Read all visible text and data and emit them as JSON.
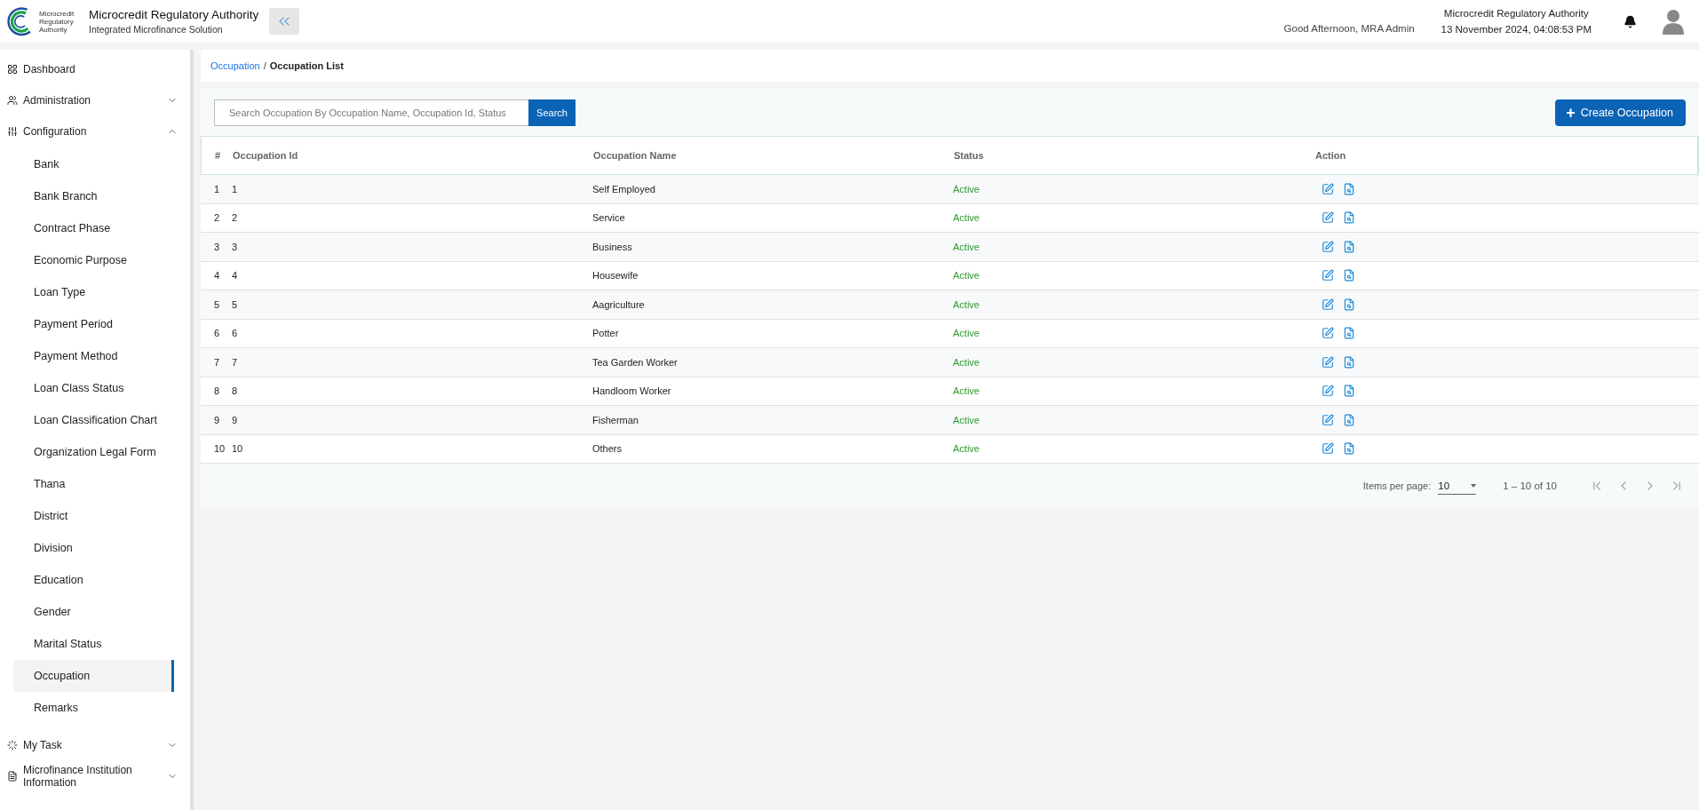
{
  "header": {
    "org_name": "Microcredit Regulatory Authority",
    "subtitle": "Integrated Microfinance Solution",
    "logo_text": "Microcredit Regulatory Authority",
    "greeting": "Good Afternoon, MRA Admin",
    "authority": "Microcredit Regulatory Authority",
    "datetime": "13 November 2024, 04:08:53 PM"
  },
  "sidebar": {
    "items": [
      {
        "kind": "link",
        "label": "Dashboard"
      },
      {
        "kind": "group",
        "label": "Administration",
        "expanded": false
      },
      {
        "kind": "group",
        "label": "Configuration",
        "expanded": true,
        "children": [
          {
            "label": "Bank",
            "selected": false
          },
          {
            "label": "Bank Branch",
            "selected": false
          },
          {
            "label": "Contract Phase",
            "selected": false
          },
          {
            "label": "Economic Purpose",
            "selected": false
          },
          {
            "label": "Loan Type",
            "selected": false
          },
          {
            "label": "Payment Period",
            "selected": false
          },
          {
            "label": "Payment Method",
            "selected": false
          },
          {
            "label": "Loan Class Status",
            "selected": false
          },
          {
            "label": "Loan Classification Chart",
            "selected": false
          },
          {
            "label": "Organization Legal Form",
            "selected": false
          },
          {
            "label": "Thana",
            "selected": false
          },
          {
            "label": "District",
            "selected": false
          },
          {
            "label": "Division",
            "selected": false
          },
          {
            "label": "Education",
            "selected": false
          },
          {
            "label": "Gender",
            "selected": false
          },
          {
            "label": "Marital Status",
            "selected": false
          },
          {
            "label": "Occupation",
            "selected": true
          },
          {
            "label": "Remarks",
            "selected": false
          }
        ]
      },
      {
        "kind": "group",
        "label": "My Task",
        "expanded": false
      },
      {
        "kind": "group",
        "label": "Microfinance Institution Information",
        "expanded": false
      }
    ]
  },
  "breadcrumb": {
    "link": "Occupation",
    "separator": "/",
    "current": "Occupation List"
  },
  "search": {
    "placeholder": "Search Occupation By Occupation Name, Occupation Id, Status",
    "button": "Search"
  },
  "create_button": {
    "icon": "+",
    "label": "Create Occupation"
  },
  "table": {
    "columns": [
      "#",
      "Occupation Id",
      "Occupation Name",
      "Status",
      "Action"
    ],
    "rows": [
      {
        "index": "1",
        "id": "1",
        "name": "Self Employed",
        "status": "Active"
      },
      {
        "index": "2",
        "id": "2",
        "name": "Service",
        "status": "Active"
      },
      {
        "index": "3",
        "id": "3",
        "name": "Business",
        "status": "Active"
      },
      {
        "index": "4",
        "id": "4",
        "name": "Housewife",
        "status": "Active"
      },
      {
        "index": "5",
        "id": "5",
        "name": "Aagriculture",
        "status": "Active"
      },
      {
        "index": "6",
        "id": "6",
        "name": "Potter",
        "status": "Active"
      },
      {
        "index": "7",
        "id": "7",
        "name": "Tea Garden Worker",
        "status": "Active"
      },
      {
        "index": "8",
        "id": "8",
        "name": "Handloom Worker",
        "status": "Active"
      },
      {
        "index": "9",
        "id": "9",
        "name": "Fisherman",
        "status": "Active"
      },
      {
        "index": "10",
        "id": "10",
        "name": "Others",
        "status": "Active"
      }
    ]
  },
  "pagination": {
    "items_per_page_label": "Items per page:",
    "page_size": "10",
    "range": "1 – 10 of 10",
    "buttons": [
      {
        "kind": "first",
        "disabled": true
      },
      {
        "kind": "prev",
        "disabled": true
      },
      {
        "kind": "next",
        "disabled": true
      },
      {
        "kind": "last",
        "disabled": true
      }
    ]
  }
}
